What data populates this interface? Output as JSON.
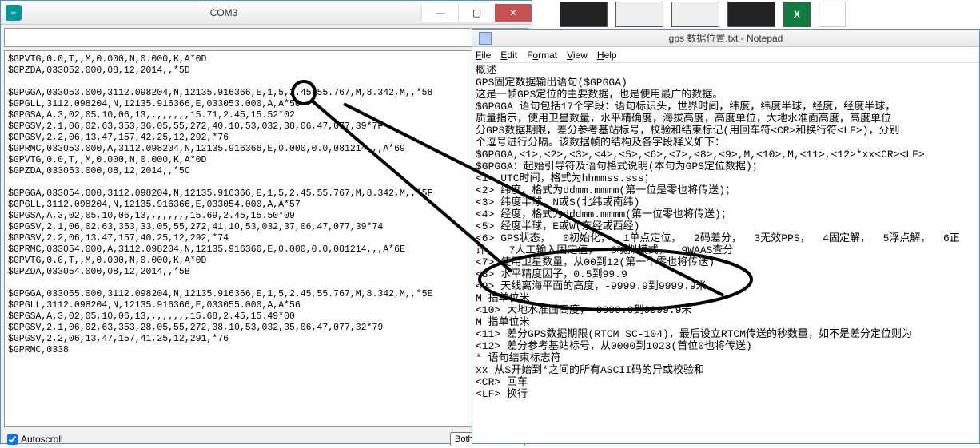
{
  "com3": {
    "title": "COM3",
    "autoscroll_label": "Autoscroll",
    "autoscroll_checked": true,
    "line_ending": "Both NL & CR",
    "lines": [
      "$GPVTG,0.0,T,,M,0.000,N,0.000,K,A*0D",
      "$GPZDA,033052.000,08,12,2014,,*5D",
      "",
      "$GPGGA,033053.000,3112.098204,N,12135.916366,E,1,5,2.45,55.767,M,8.342,M,,*58",
      "$GPGLL,3112.098204,N,12135.916366,E,033053.000,A,A*50",
      "$GPGSA,A,3,02,05,10,06,13,,,,,,,,15.71,2.45,15.52*02",
      "$GPGSV,2,1,06,02,63,353,36,05,55,272,40,10,53,032,38,06,47,077,39*7F",
      "$GPGSV,2,2,06,13,47,157,42,25,12,292,*76",
      "$GPRMC,033053.000,A,3112.098204,N,12135.916366,E,0.000,0.0,081214,,,A*69",
      "$GPVTG,0.0,T,,M,0.000,N,0.000,K,A*0D",
      "$GPZDA,033053.000,08,12,2014,,*5C",
      "",
      "$GPGGA,033054.000,3112.098204,N,12135.916366,E,1,5,2.45,55.767,M,8.342,M,,*5F",
      "$GPGLL,3112.098204,N,12135.916366,E,033054.000,A,A*57",
      "$GPGSA,A,3,02,05,10,06,13,,,,,,,,15.69,2.45,15.50*09",
      "$GPGSV,2,1,06,02,63,353,33,05,55,272,41,10,53,032,37,06,47,077,39*74",
      "$GPGSV,2,2,06,13,47,157,40,25,12,292,*74",
      "$GPRMC,033054.000,A,3112.098204,N,12135.916366,E,0.000,0.0,081214,,,A*6E",
      "$GPVTG,0.0,T,,M,0.000,N,0.000,K,A*0D",
      "$GPZDA,033054.000,08,12,2014,,*5B",
      "",
      "$GPGGA,033055.000,3112.098204,N,12135.916366,E,1,5,2.45,55.767,M,8.342,M,,*5E",
      "$GPGLL,3112.098204,N,12135.916366,E,033055.000,A,A*56",
      "$GPGSA,A,3,02,05,10,06,13,,,,,,,,15.68,2.45,15.49*00",
      "$GPGSV,2,1,06,02,63,353,28,05,55,272,38,10,53,032,35,06,47,077,32*79",
      "$GPGSV,2,2,06,13,47,157,41,25,12,291,*76",
      "$GPRMC,0338"
    ]
  },
  "notepad": {
    "title": "gps 数据位置.txt - Notepad",
    "menu": {
      "file": "File",
      "edit": "Edit",
      "format": "Format",
      "view": "View",
      "help": "Help"
    },
    "content": "概述\nGPS固定数据输出语句($GPGGA)\n这是一帧GPS定位的主要数据，也是使用最广的数据。\n$GPGGA 语句包括17个字段：语句标识头，世界时间，纬度，纬度半球，经度，经度半球，\n质量指示，使用卫星数量，水平精确度，海拔高度，高度单位，大地水准面高度，高度单位\n分GPS数据期限，差分参考基站标号，校验和结束标记(用回车符<CR>和换行符<LF>)，分别\n个逗号进行分隔。该数据帧的结构及各字段释义如下：\n$GPGGA,<1>,<2>,<3>,<4>,<5>,<6>,<7>,<8>,<9>,M,<10>,M,<11>,<12>*xx<CR><LF>\n$GPGGA：起始引导符及语句格式说明(本句为GPS定位数据)；\n<1> UTC时间，格式为hhmmss.sss；\n<2> 纬度，格式为ddmm.mmmm(第一位是零也将传送)；\n<3> 纬度半球，N或S(北纬或南纬)\n<4> 经度，格式为dddmm.mmmm(第一位零也将传送)；\n<5> 经度半球，E或W(东经或西经)\n<6> GPS状态，  0初始化，  1单点定位，  2码差分，  3无效PPS，  4固定解，  5浮点解，  6正\n计，  7人工输入固定值，  8模拟模式，  9WAAS查分\n<7> 使用卫星数量，从00到12(第一个零也将传送)\n<8> 水平精度因子，0.5到99.9\n<9> 天线离海平面的高度，-9999.9到9999.9米\nM 指单位米\n<10> 大地水准面高度，-9999.9到9999.9米\nM 指单位米\n<11> 差分GPS数据期限(RTCM SC-104)，最后设立RTCM传送的秒数量，如不是差分定位则为\n<12> 差分参考基站标号，从0000到1023(首位0也将传送)\n* 语句结束标志符\nxx 从$开始到*之间的所有ASCII码的异或校验和\n<CR> 回车\n<LF> 换行"
  },
  "thumbs": {
    "excel": "X"
  }
}
